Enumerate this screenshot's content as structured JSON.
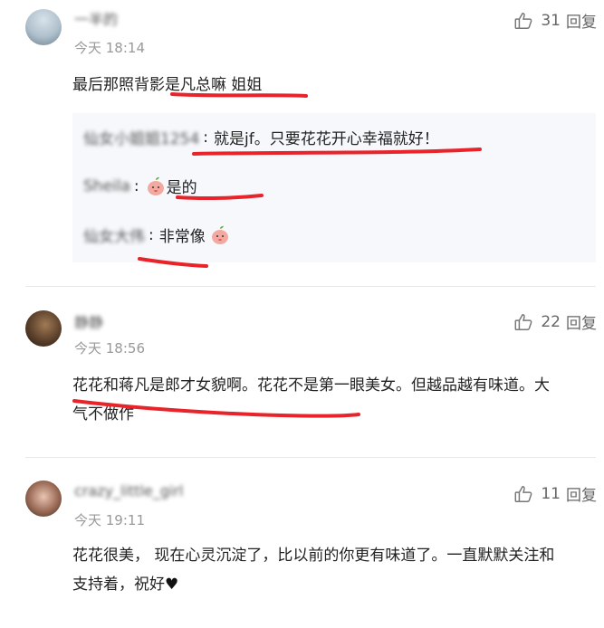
{
  "comments": [
    {
      "name": "一半的",
      "time": "今天 18:14",
      "likes": "31",
      "reply_label": "回复",
      "text": "最后那照背影是凡总嘛 姐姐",
      "replies": [
        {
          "name": "仙女小姐姐1254",
          "text": "就是jf。只要花花开心幸福就好！"
        },
        {
          "name": "Sheila",
          "text": "是的"
        },
        {
          "name": "仙女大伟",
          "text": "非常像"
        }
      ]
    },
    {
      "name": "静静",
      "time": "今天 18:56",
      "likes": "22",
      "reply_label": "回复",
      "text_line1": "花花和蒋凡是郎才女貌啊。花花不是第一眼美女。但越品越有味道。大",
      "text_line2": "气不做作"
    },
    {
      "name": "crazy_little_girl",
      "time": "今天 19:11",
      "likes": "11",
      "reply_label": "回复",
      "text_line1": "花花很美， 现在心灵沉淀了，比以前的你更有味道了。一直默默关注和",
      "text_line2": "支持着，祝好"
    }
  ],
  "icons": {
    "like": "thumbs-up-icon",
    "emoji": "peach-emoji-icon",
    "heart": "heart-icon"
  },
  "colors": {
    "underline": "#e8232a",
    "reply_bg": "#f6f8fb",
    "meta": "#999999"
  }
}
